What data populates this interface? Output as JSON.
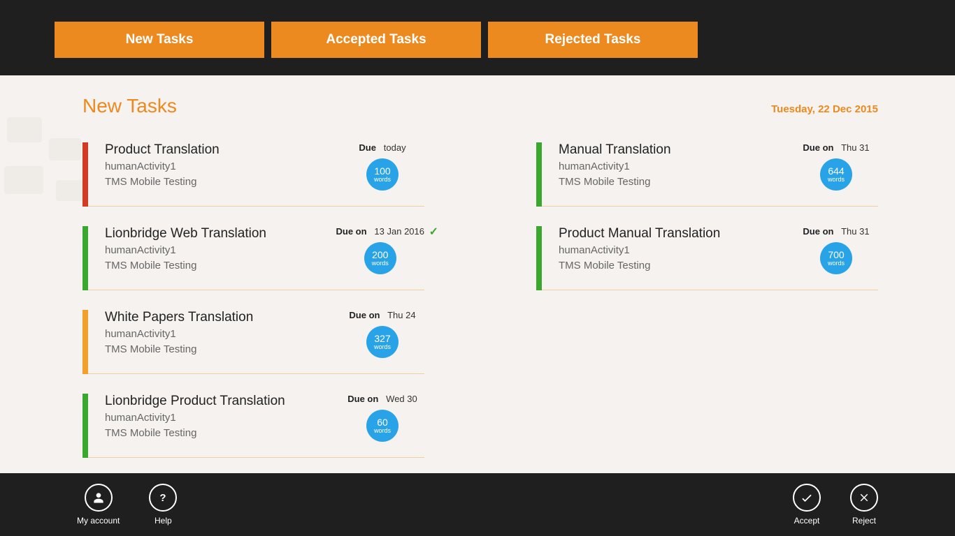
{
  "tabs": {
    "new": "New Tasks",
    "accepted": "Accepted Tasks",
    "rejected": "Rejected Tasks"
  },
  "page": {
    "title": "New Tasks",
    "date": "Tuesday, 22 Dec 2015"
  },
  "left": [
    {
      "stripe": "red",
      "title": "Product Translation",
      "activity": "humanActivity1",
      "project": "TMS Mobile Testing",
      "dueLabel": "Due",
      "dueVal": "today",
      "words": "100",
      "check": false
    },
    {
      "stripe": "green",
      "title": "Lionbridge Web Translation",
      "activity": "humanActivity1",
      "project": "TMS Mobile Testing",
      "dueLabel": "Due on",
      "dueVal": "13 Jan 2016",
      "words": "200",
      "check": true
    },
    {
      "stripe": "orange",
      "title": "White Papers Translation",
      "activity": "humanActivity1",
      "project": "TMS Mobile Testing",
      "dueLabel": "Due on",
      "dueVal": "Thu 24",
      "words": "327",
      "check": false
    },
    {
      "stripe": "green",
      "title": "Lionbridge Product Translation",
      "activity": "humanActivity1",
      "project": "TMS Mobile Testing",
      "dueLabel": "Due on",
      "dueVal": "Wed 30",
      "words": "60",
      "check": false
    }
  ],
  "right": [
    {
      "stripe": "green",
      "title": "Manual Translation",
      "activity": "humanActivity1",
      "project": "TMS Mobile Testing",
      "dueLabel": "Due on",
      "dueVal": "Thu 31",
      "words": "644",
      "check": false
    },
    {
      "stripe": "green",
      "title": "Product Manual Translation",
      "activity": "humanActivity1",
      "project": "TMS Mobile Testing",
      "dueLabel": "Due on",
      "dueVal": "Thu 31",
      "words": "700",
      "check": false
    }
  ],
  "bottom": {
    "account": "My account",
    "help": "Help",
    "accept": "Accept",
    "reject": "Reject"
  },
  "wordsLabel": "words"
}
